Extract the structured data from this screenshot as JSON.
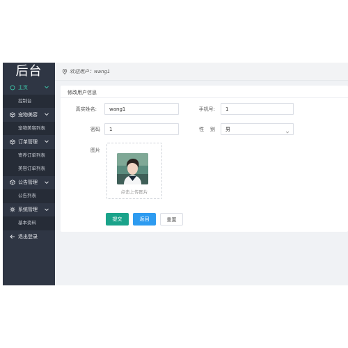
{
  "app": {
    "logo": "后台"
  },
  "header": {
    "welcome": "欢迎用户：wang1"
  },
  "sidebar": {
    "items": [
      {
        "label": "主页",
        "icon": "home-icon",
        "active": true,
        "children": [
          "控制台"
        ]
      },
      {
        "label": "宠物美容",
        "icon": "cube-icon",
        "children": [
          "宠物美容列表"
        ]
      },
      {
        "label": "订单管理",
        "icon": "cube-icon",
        "children": [
          "寄养订单列表",
          "美容订单列表"
        ]
      },
      {
        "label": "公告管理",
        "icon": "cube-icon",
        "children": [
          "公告列表"
        ]
      },
      {
        "label": "系统管理",
        "icon": "gear-icon",
        "children": [
          "基本资料"
        ]
      },
      {
        "label": "退出登录",
        "icon": "arrow-left-icon",
        "children": []
      }
    ]
  },
  "form": {
    "title": "修改用户信息",
    "real_name_label": "真实姓名:",
    "real_name_value": "wang1",
    "phone_label": "手机号:",
    "phone_value": "1",
    "password_label": "密码",
    "password_value": "1",
    "gender_label": "性    别",
    "gender_value": "男",
    "image_label": "图片",
    "upload_text": "点击上传图片"
  },
  "buttons": {
    "submit": "提交",
    "back": "返回",
    "reset": "重置"
  },
  "colors": {
    "sidebar_bg": "#2f3644",
    "accent": "#1aa38a",
    "back_btn": "#2d9bf0"
  }
}
